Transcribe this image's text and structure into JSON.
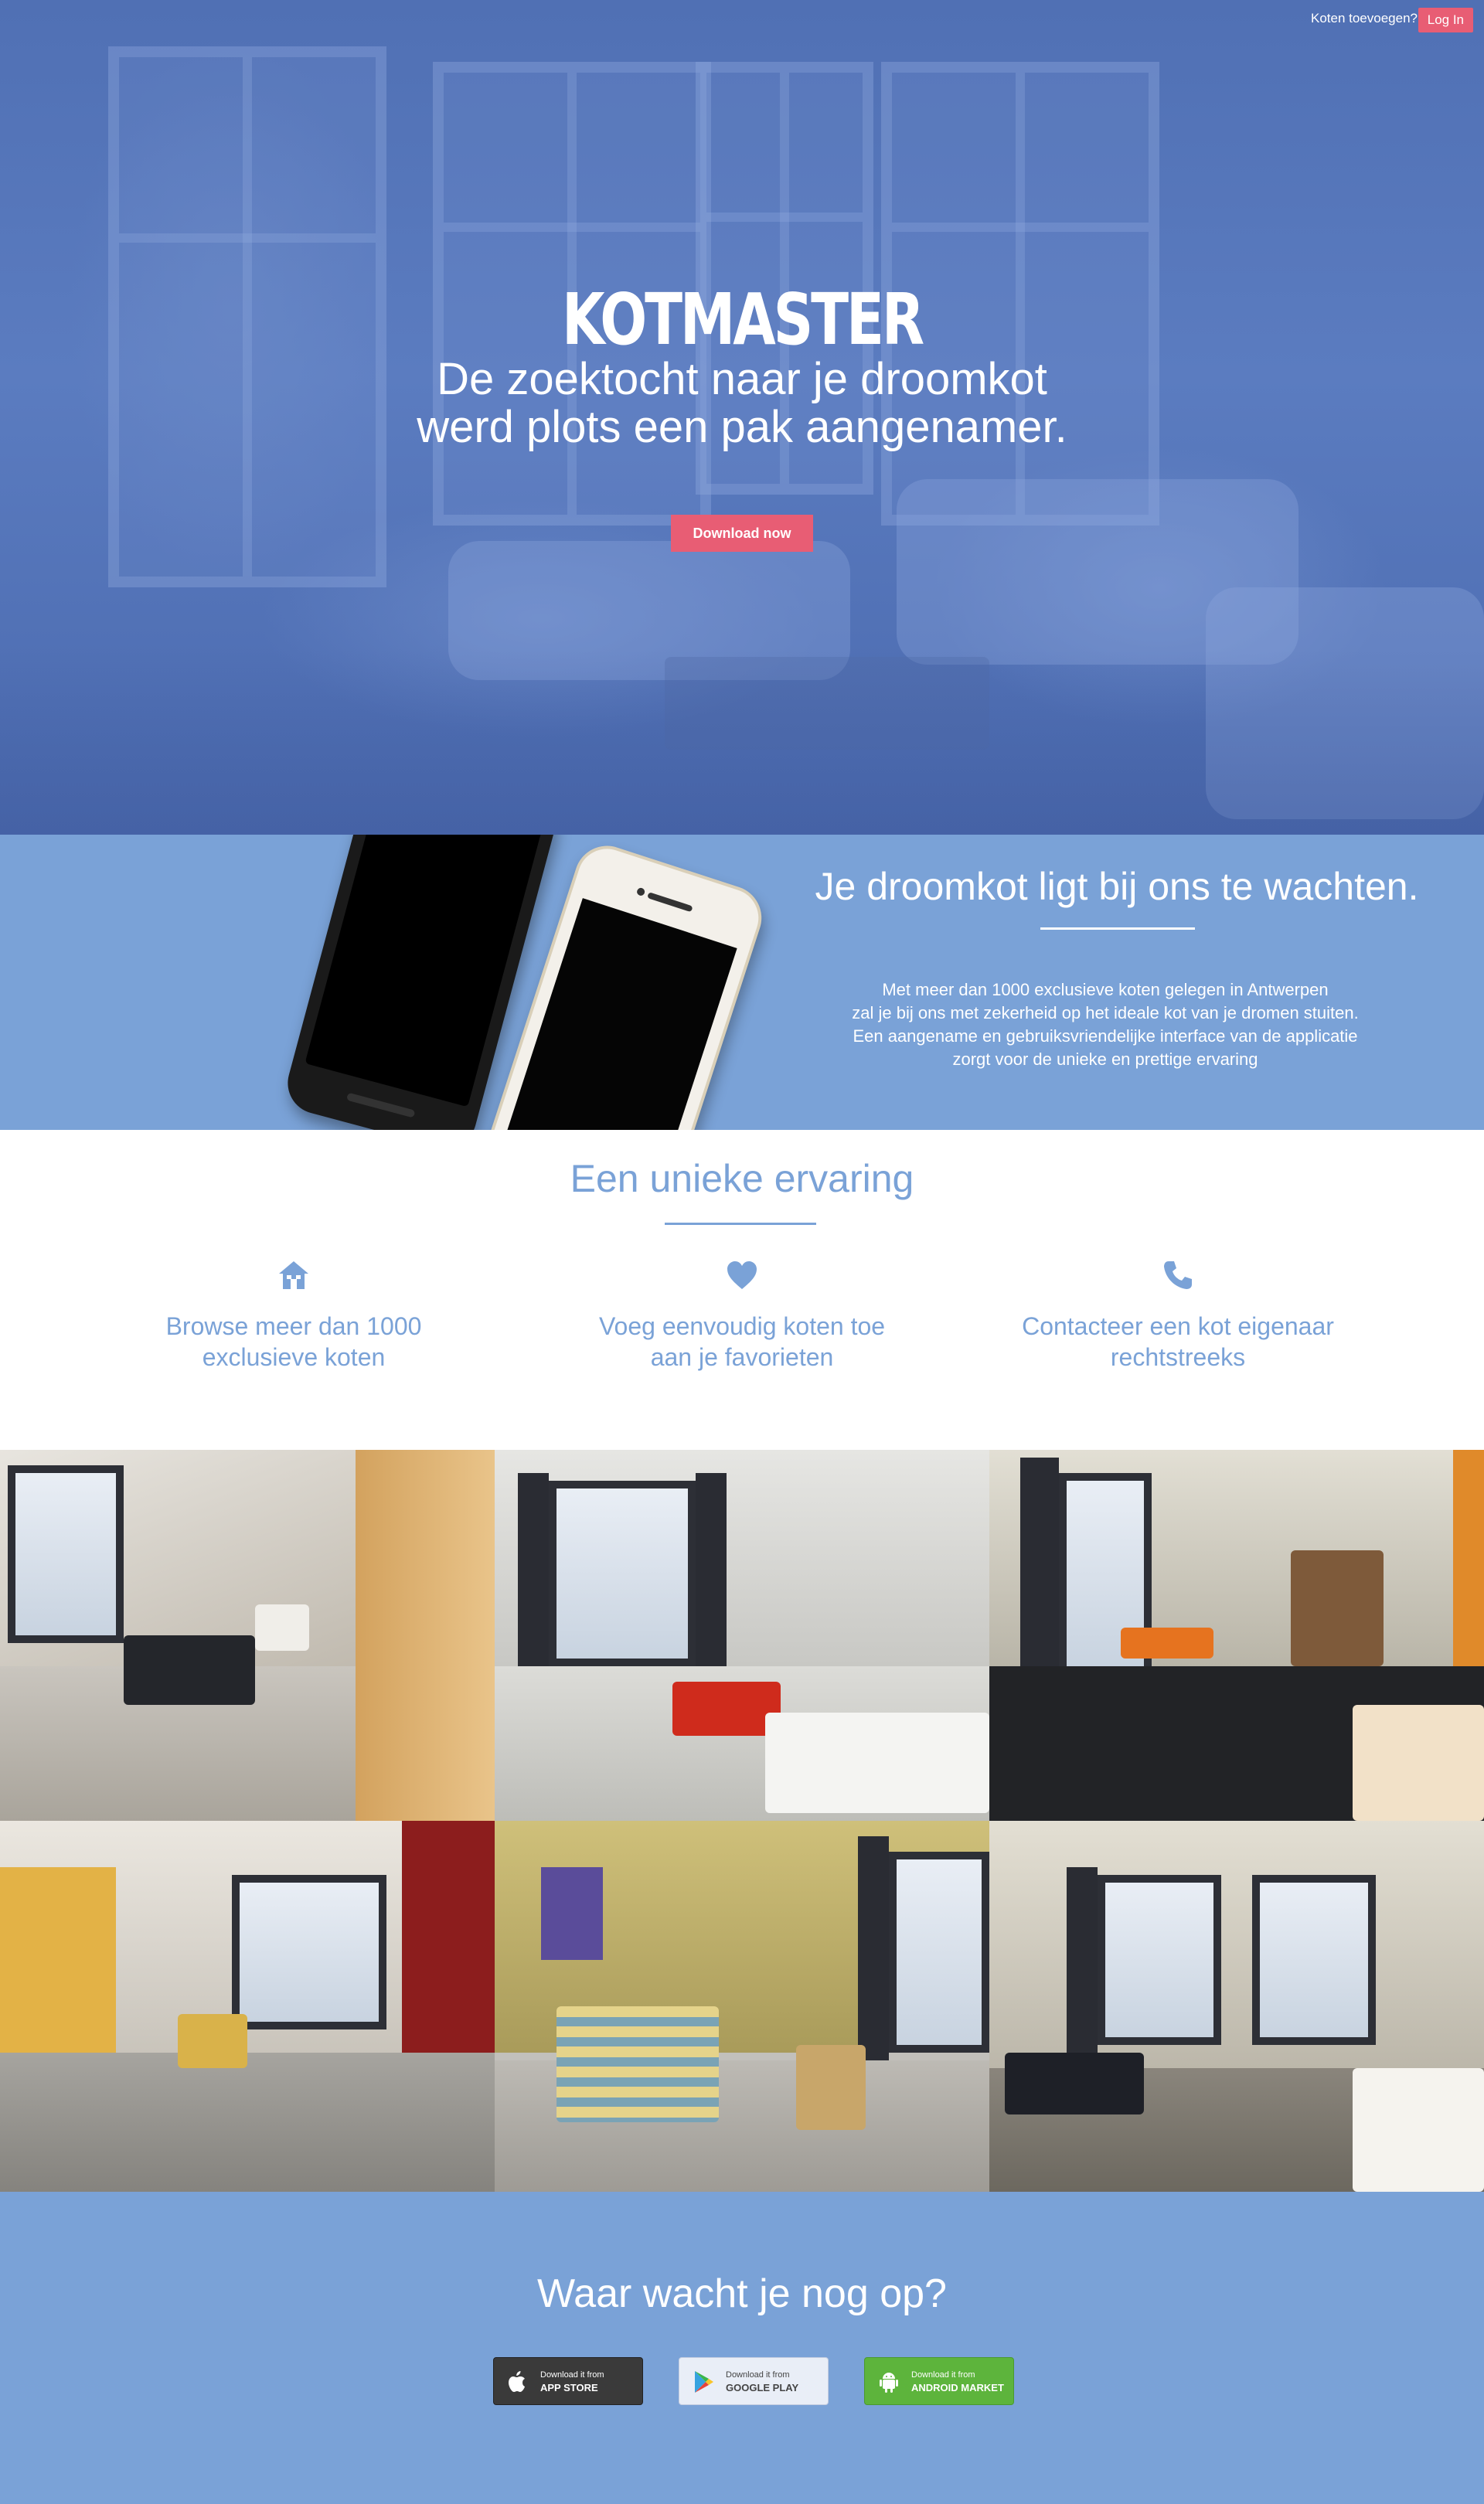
{
  "header": {
    "add_link": "Koten toevoegen?",
    "login_label": "Log In"
  },
  "hero": {
    "title": "KOTMASTER",
    "subtitle_line1": "De zoektocht naar je droomkot",
    "subtitle_line2": "werd plots een pak aangenamer.",
    "cta_label": "Download now"
  },
  "promo": {
    "title": "Je droomkot ligt bij ons te wachten.",
    "lines": [
      "Met meer dan 1000 exclusieve koten gelegen in Antwerpen",
      "zal je bij ons met zekerheid op het ideale kot van je dromen stuiten.",
      "Een aangename en gebruiksvriendelijke interface van de applicatie",
      "zorgt voor de unieke en prettige ervaring"
    ]
  },
  "features": {
    "title": "Een unieke ervaring",
    "items": [
      {
        "icon": "house-icon",
        "line1": "Browse meer dan 1000",
        "line2": "exclusieve koten"
      },
      {
        "icon": "heart-icon",
        "line1": "Voeg eenvoudig koten toe",
        "line2": "aan je favorieten"
      },
      {
        "icon": "phone-icon",
        "line1": "Contacteer een kot eigenaar",
        "line2": "rechtstreeks"
      }
    ]
  },
  "cta": {
    "title": "Waar wacht je nog op?",
    "stores": [
      {
        "icon": "apple-icon",
        "small": "Download it from",
        "big": "APP STORE",
        "color": "#3a3a3a"
      },
      {
        "icon": "google-play-icon",
        "small": "Download it from",
        "big": "GOOGLE PLAY",
        "color": "#e9eef7"
      },
      {
        "icon": "android-icon",
        "small": "Download it from",
        "big": "ANDROID MARKET",
        "color": "#5db43c"
      }
    ]
  },
  "colors": {
    "accent": "#7aa2d7",
    "button": "#e85d74",
    "hero_overlay": "#5070b4"
  }
}
